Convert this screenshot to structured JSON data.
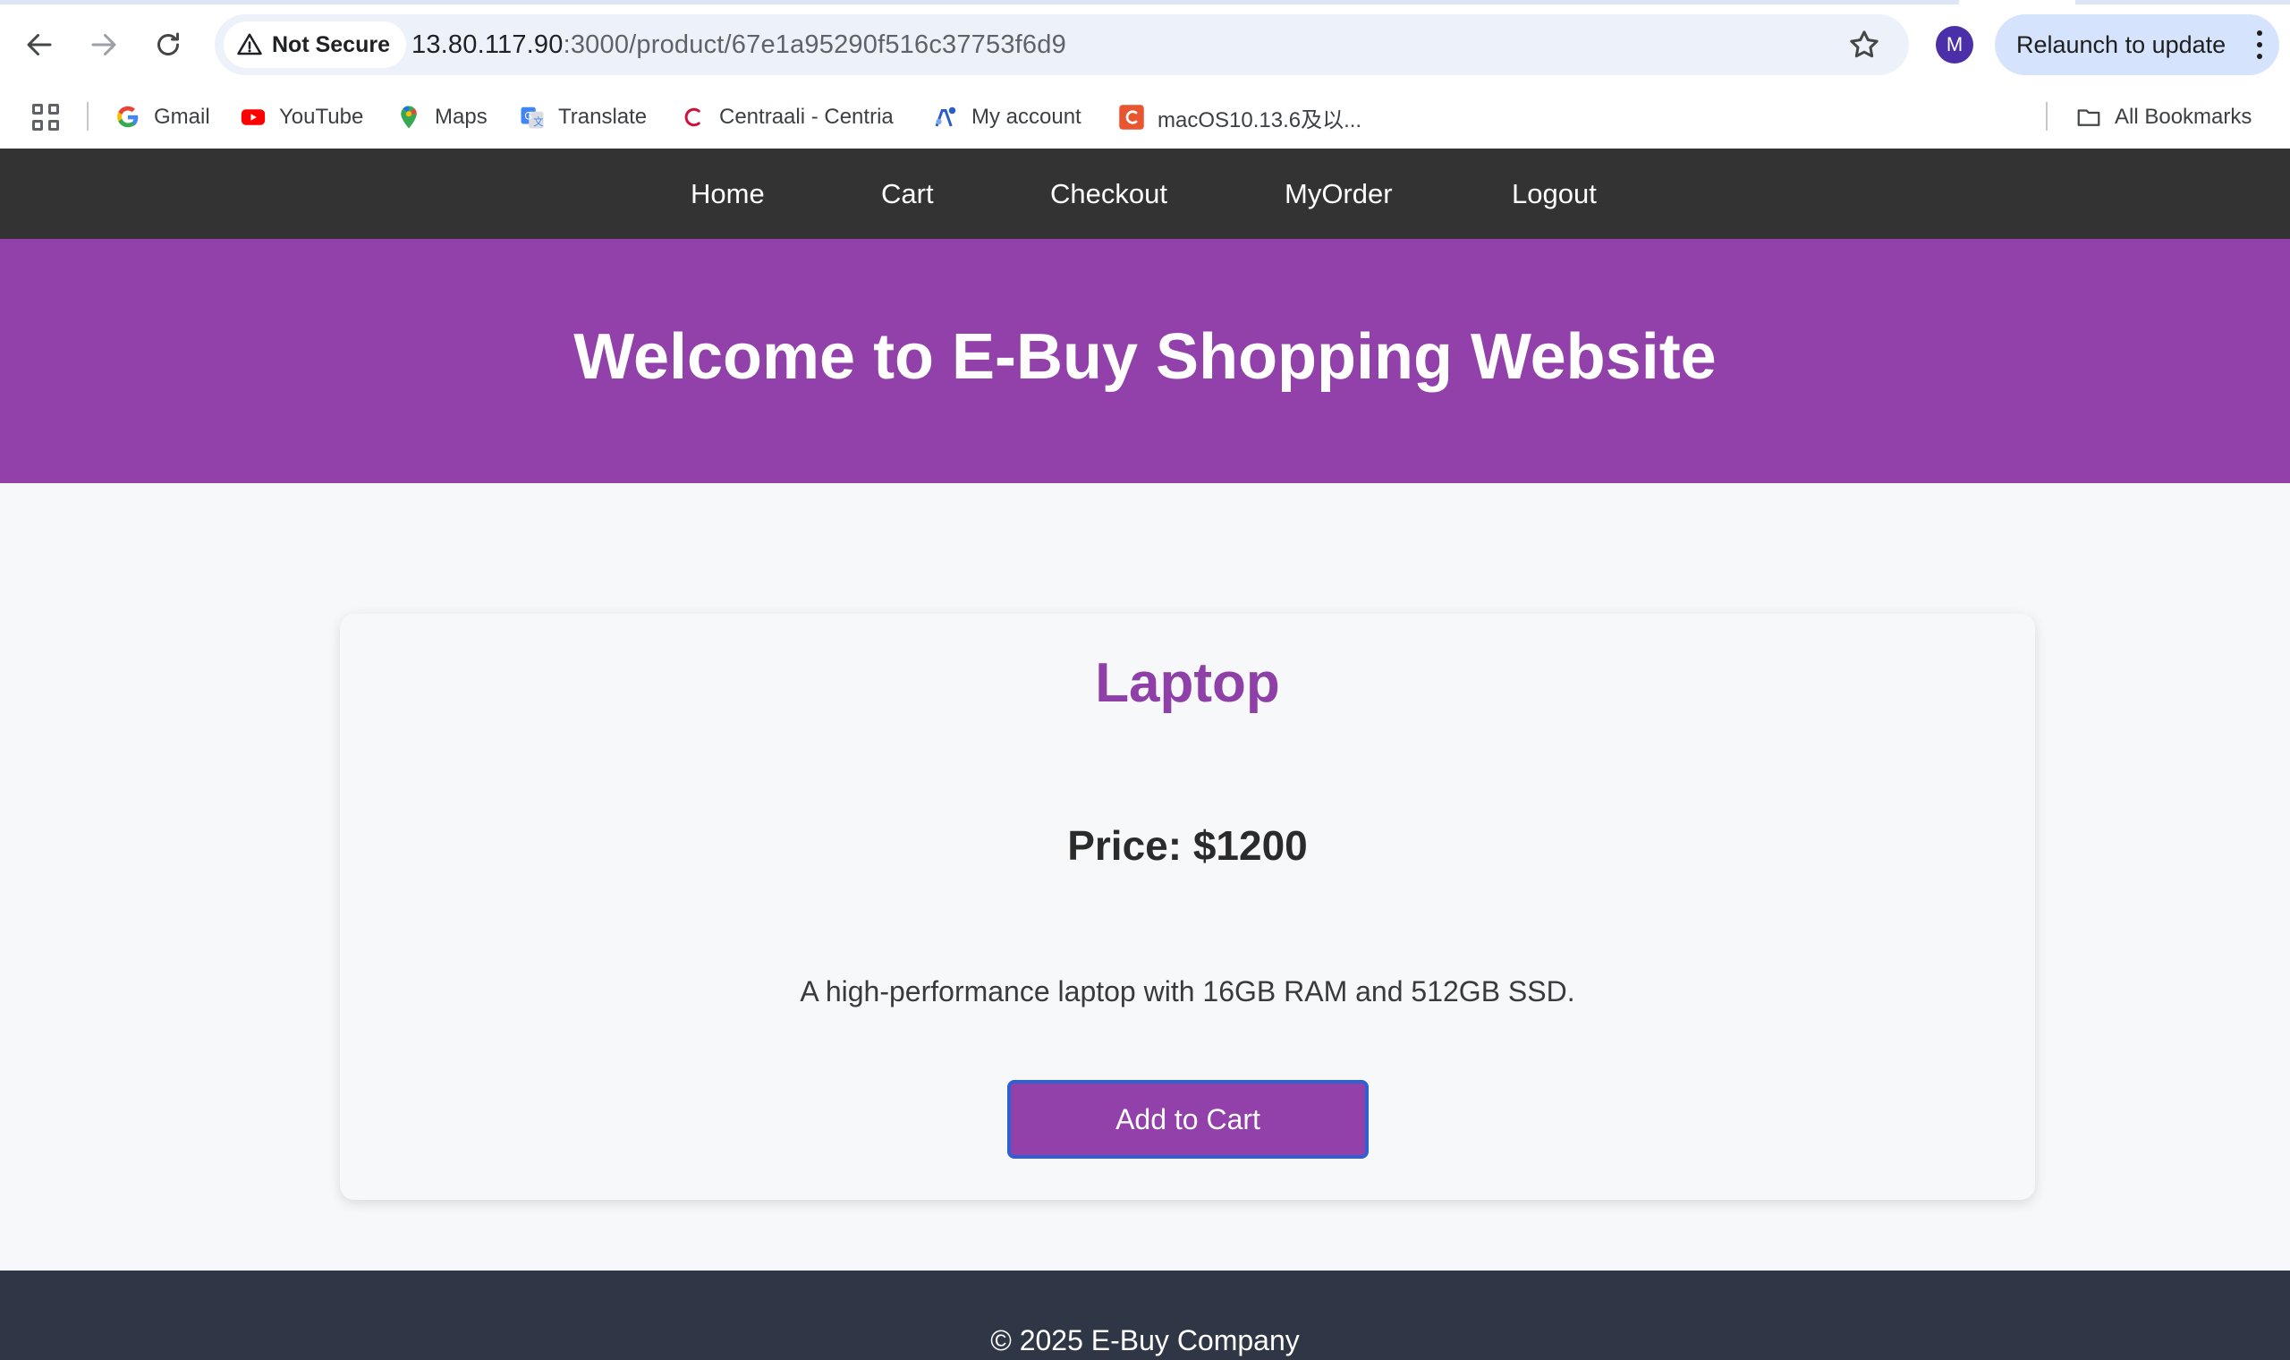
{
  "browser": {
    "security_label": "Not Secure",
    "url_host": "13.80.117.90",
    "url_path": ":3000/product/67e1a95290f516c37753f6d9",
    "profile_initial": "M",
    "relaunch_label": "Relaunch to update"
  },
  "bookmarks": {
    "items": [
      {
        "label": "Gmail",
        "icon": "google-icon"
      },
      {
        "label": "YouTube",
        "icon": "youtube-icon"
      },
      {
        "label": "Maps",
        "icon": "maps-icon"
      },
      {
        "label": "Translate",
        "icon": "translate-icon"
      },
      {
        "label": "Centraali - Centria",
        "icon": "centria-icon"
      },
      {
        "label": "My account",
        "icon": "account-icon"
      },
      {
        "label": "macOS10.13.6及以...",
        "icon": "c-icon"
      }
    ],
    "all_bookmarks_label": "All Bookmarks"
  },
  "site": {
    "nav": [
      "Home",
      "Cart",
      "Checkout",
      "MyOrder",
      "Logout"
    ],
    "hero_title": "Welcome to E-Buy Shopping Website",
    "footer_text": "© 2025 E-Buy Company"
  },
  "product": {
    "name": "Laptop",
    "price": "Price: $1200",
    "description": "A high-performance laptop with 16GB RAM and 512GB SSD.",
    "add_to_cart_label": "Add to Cart"
  },
  "colors": {
    "accent": "#9240aa",
    "nav_bg": "#333333",
    "footer_bg": "#2f3747"
  }
}
